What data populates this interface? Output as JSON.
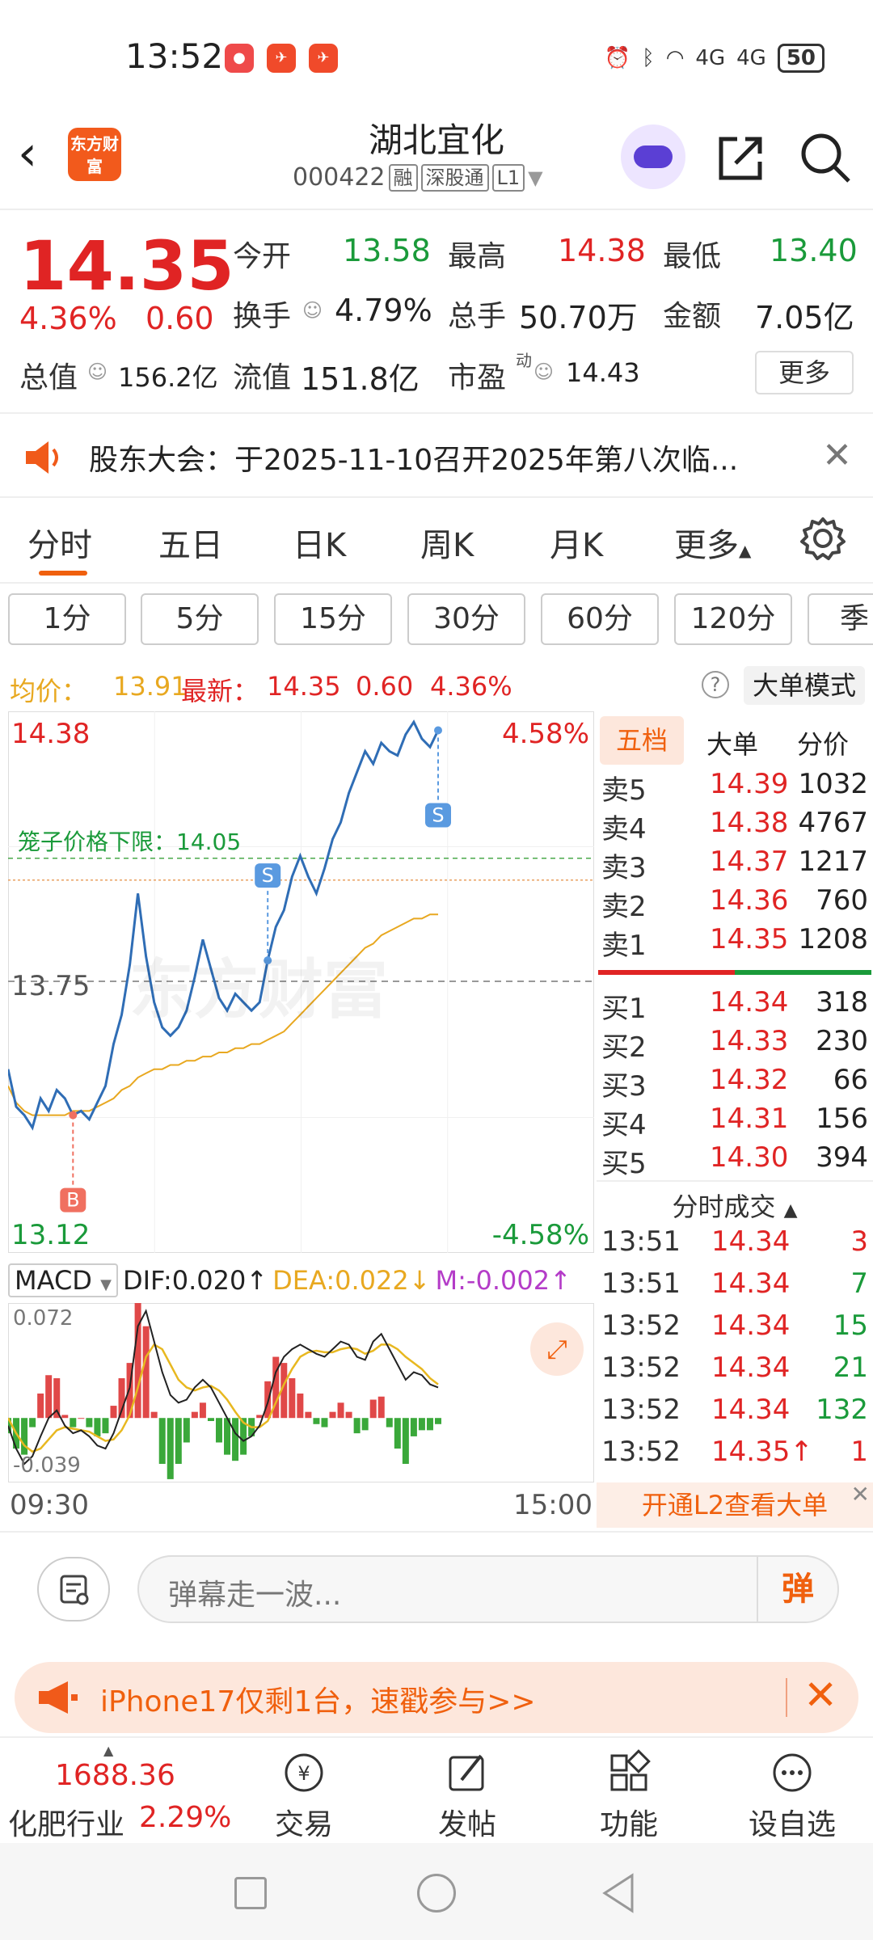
{
  "status_bar": {
    "time": "13:52",
    "network": "4G",
    "battery": "50"
  },
  "header": {
    "logo_text": "东方财富",
    "stock_name": "湖北宜化",
    "stock_code": "000422",
    "tags": [
      "融",
      "深股通",
      "L1"
    ]
  },
  "quote": {
    "price": "14.35",
    "change_pct": "4.36%",
    "change": "0.60",
    "open_label": "今开",
    "open": "13.58",
    "high_label": "最高",
    "high": "14.38",
    "low_label": "最低",
    "low": "13.40",
    "turnover_label": "换手",
    "turnover": "4.79%",
    "volume_label": "总手",
    "volume": "50.70万",
    "amount_label": "金额",
    "amount": "7.05亿",
    "mktcap_label": "总值",
    "mktcap": "156.2亿",
    "float_label": "流值",
    "float": "151.8亿",
    "pe_label": "市盈",
    "pe_sup": "动",
    "pe": "14.43",
    "more_button": "更多"
  },
  "notice": {
    "text": "股东大会：于2025-11-10召开2025年第八次临..."
  },
  "tabs": [
    "分时",
    "五日",
    "日K",
    "周K",
    "月K",
    "更多"
  ],
  "periods": [
    "1分",
    "5分",
    "15分",
    "30分",
    "60分",
    "120分",
    "季"
  ],
  "avg_bar": {
    "avg_label": "均价：",
    "avg": "13.91",
    "latest_label": "最新：",
    "latest": "14.35",
    "change": "0.60",
    "pct": "4.36%",
    "bigmode": "大单模式"
  },
  "chart_data": {
    "type": "line",
    "title": "",
    "y_max_label": "14.38",
    "y_mid_label": "13.75",
    "y_min_label": "13.12",
    "pct_max_label": "4.58%",
    "pct_min_label": "-4.58%",
    "limit_label": "笼子价格下限：14.05",
    "watermark": "东方财富",
    "ylim": [
      13.12,
      14.38
    ],
    "x_start": "09:30",
    "x_end": "15:00",
    "series": [
      {
        "name": "",
        "color": "#2f6db5",
        "values": [
          13.54,
          13.45,
          13.43,
          13.4,
          13.47,
          13.44,
          13.49,
          13.47,
          13.43,
          13.44,
          13.42,
          13.46,
          13.5,
          13.6,
          13.67,
          13.79,
          13.96,
          13.81,
          13.7,
          13.64,
          13.62,
          13.64,
          13.68,
          13.76,
          13.85,
          13.78,
          13.71,
          13.68,
          13.72,
          13.7,
          13.68,
          13.7,
          13.8,
          13.88,
          13.92,
          14.0,
          14.05,
          14.0,
          13.96,
          14.02,
          14.09,
          14.13,
          14.2,
          14.25,
          14.3,
          14.27,
          14.32,
          14.3,
          14.29,
          14.34,
          14.37,
          14.33,
          14.31,
          14.35
        ]
      },
      {
        "name": "",
        "color": "#e8a820",
        "values": [
          13.5,
          13.46,
          13.44,
          13.43,
          13.43,
          13.43,
          13.43,
          13.43,
          13.44,
          13.44,
          13.44,
          13.45,
          13.46,
          13.47,
          13.49,
          13.5,
          13.52,
          13.53,
          13.54,
          13.54,
          13.55,
          13.55,
          13.56,
          13.56,
          13.57,
          13.57,
          13.58,
          13.58,
          13.59,
          13.59,
          13.6,
          13.6,
          13.61,
          13.62,
          13.63,
          13.65,
          13.67,
          13.69,
          13.71,
          13.73,
          13.75,
          13.77,
          13.79,
          13.81,
          13.83,
          13.84,
          13.86,
          13.87,
          13.88,
          13.89,
          13.9,
          13.9,
          13.91,
          13.91
        ]
      }
    ],
    "markers": [
      {
        "label": "B",
        "index": 8,
        "color": "#f07060"
      },
      {
        "label": "S",
        "index": 32,
        "color": "#5a9ae0"
      },
      {
        "label": "S",
        "index": 53,
        "color": "#5a9ae0"
      }
    ],
    "macd": {
      "select_label": "MACD",
      "dif_label": "DIF:0.020↑",
      "dea_label": "DEA:0.022↓",
      "m_label": "M:-0.002↑",
      "y_top_label": "0.072",
      "y_bottom_label": "-0.039",
      "ylim": [
        -0.039,
        0.072
      ],
      "dif": [
        -0.005,
        -0.02,
        -0.03,
        -0.025,
        -0.012,
        0.0,
        0.005,
        -0.005,
        -0.01,
        -0.008,
        -0.012,
        -0.018,
        -0.02,
        -0.01,
        0.005,
        0.02,
        0.06,
        0.07,
        0.05,
        0.03,
        0.015,
        0.01,
        0.012,
        0.02,
        0.025,
        0.02,
        0.01,
        0.0,
        -0.01,
        -0.015,
        -0.012,
        -0.005,
        0.01,
        0.03,
        0.04,
        0.045,
        0.048,
        0.045,
        0.042,
        0.04,
        0.045,
        0.05,
        0.048,
        0.04,
        0.038,
        0.05,
        0.055,
        0.045,
        0.035,
        0.025,
        0.03,
        0.028,
        0.022,
        0.02
      ],
      "dea": [
        0.0,
        -0.01,
        -0.018,
        -0.022,
        -0.02,
        -0.014,
        -0.008,
        -0.006,
        -0.007,
        -0.008,
        -0.009,
        -0.012,
        -0.015,
        -0.014,
        -0.008,
        0.002,
        0.02,
        0.04,
        0.048,
        0.045,
        0.035,
        0.025,
        0.02,
        0.018,
        0.02,
        0.021,
        0.018,
        0.012,
        0.004,
        -0.003,
        -0.006,
        -0.006,
        -0.002,
        0.01,
        0.022,
        0.032,
        0.04,
        0.043,
        0.044,
        0.043,
        0.043,
        0.045,
        0.046,
        0.045,
        0.042,
        0.044,
        0.048,
        0.048,
        0.045,
        0.04,
        0.036,
        0.032,
        0.026,
        0.022
      ],
      "m": [
        -0.01,
        -0.02,
        -0.024,
        -0.006,
        0.016,
        0.028,
        0.026,
        0.002,
        -0.006,
        0.0,
        -0.006,
        -0.012,
        -0.01,
        0.008,
        0.026,
        0.036,
        0.08,
        0.06,
        0.004,
        -0.03,
        -0.04,
        -0.03,
        -0.016,
        0.004,
        0.01,
        -0.002,
        -0.016,
        -0.024,
        -0.028,
        -0.024,
        -0.012,
        0.002,
        0.024,
        0.04,
        0.036,
        0.026,
        0.016,
        0.004,
        -0.004,
        -0.006,
        0.004,
        0.01,
        0.004,
        -0.01,
        -0.008,
        0.012,
        0.014,
        -0.006,
        -0.02,
        -0.03,
        -0.012,
        -0.008,
        -0.008,
        -0.004
      ]
    }
  },
  "order_book": {
    "tabs": [
      "五档",
      "大单",
      "分价"
    ],
    "asks": [
      {
        "label": "卖5",
        "price": "14.39",
        "vol": "1032"
      },
      {
        "label": "卖4",
        "price": "14.38",
        "vol": "4767"
      },
      {
        "label": "卖3",
        "price": "14.37",
        "vol": "1217"
      },
      {
        "label": "卖2",
        "price": "14.36",
        "vol": "760"
      },
      {
        "label": "卖1",
        "price": "14.35",
        "vol": "1208"
      }
    ],
    "bids": [
      {
        "label": "买1",
        "price": "14.34",
        "vol": "318"
      },
      {
        "label": "买2",
        "price": "14.33",
        "vol": "230"
      },
      {
        "label": "买3",
        "price": "14.32",
        "vol": "66"
      },
      {
        "label": "买4",
        "price": "14.31",
        "vol": "156"
      },
      {
        "label": "买5",
        "price": "14.30",
        "vol": "394"
      }
    ],
    "trades_header": "分时成交",
    "trades": [
      {
        "time": "13:51",
        "price": "14.34",
        "vol": "3",
        "color": "#e02424"
      },
      {
        "time": "13:51",
        "price": "14.34",
        "vol": "7",
        "color": "#1a9a3a"
      },
      {
        "time": "13:52",
        "price": "14.34",
        "vol": "15",
        "color": "#1a9a3a"
      },
      {
        "time": "13:52",
        "price": "14.34",
        "vol": "21",
        "color": "#1a9a3a"
      },
      {
        "time": "13:52",
        "price": "14.34",
        "vol": "132",
        "color": "#1a9a3a"
      },
      {
        "time": "13:52",
        "price": "14.35↑",
        "vol": "1",
        "color": "#e02424"
      }
    ],
    "l2_banner": "开通L2查看大单"
  },
  "danmaku": {
    "placeholder": "弹幕走一波...",
    "send_label": "弹"
  },
  "promo": {
    "text": "iPhone17仅剩1台，速戳参与>>"
  },
  "bottom_nav": {
    "index_value": "1688.36",
    "index_name": "化肥行业",
    "index_pct": "2.29%",
    "items": [
      "交易",
      "发帖",
      "功能",
      "设自选"
    ]
  },
  "colors": {
    "up": "#e02424",
    "down": "#1a9a3a",
    "accent": "#f0600e"
  }
}
